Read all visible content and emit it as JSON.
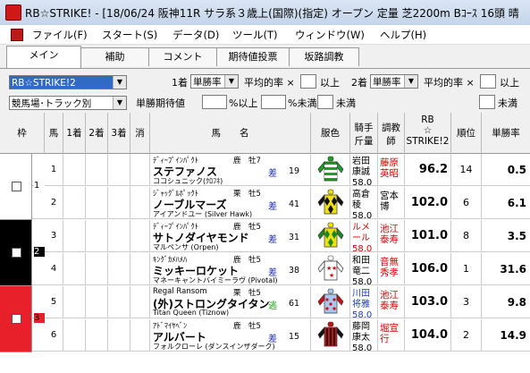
{
  "window": {
    "title": "RB☆STRIKE! - [18/06/24 阪神11R サラ系３歳上(国際)(指定) オープン 定量 芝2200m Bｺｰｽ 16頭 晴"
  },
  "menu": [
    {
      "label": "ファイル(F)"
    },
    {
      "label": "スタート(S)"
    },
    {
      "label": "データ(D)"
    },
    {
      "label": "ツール(T)"
    },
    {
      "label": "ウィンドウ(W)"
    },
    {
      "label": "ヘルプ(H)"
    }
  ],
  "tabs": [
    {
      "label": "メイン"
    },
    {
      "label": "補助"
    },
    {
      "label": "コメント"
    },
    {
      "label": "期待値投票"
    },
    {
      "label": "坂路調教"
    }
  ],
  "filters": {
    "index_select": "RB☆STRIKE!2",
    "course_select": "競馬場･トラック別",
    "bet1_label": "1着",
    "bet1_value": "単勝率",
    "avg1_label": "平均的率 ×",
    "above1": "以上",
    "bet2_label": "2着",
    "bet2_value": "単勝率",
    "avg2_label": "平均的率 ×",
    "above2": "以上",
    "ev_label": "単勝期待値",
    "ev_unit_above": "%以上",
    "ev_unit_below": "%未満",
    "below1": "未満",
    "below2": "未満"
  },
  "columns": {
    "waku": "枠",
    "uma": "馬",
    "c1": "1着",
    "c2": "2着",
    "c3": "3着",
    "kesu": "消",
    "name": "馬　　名",
    "silk": "服色",
    "jockey": "騎手/斤量",
    "trainer": "調教/師",
    "rb": "RB/☆/STRIKE!2",
    "rank": "順位",
    "win": "単勝率"
  },
  "horses": [
    {
      "waku": "1",
      "num": "1",
      "sire": "ﾃﾞｨｰﾌﾟｲﾝﾊﾟｸﾄ",
      "sex_age": "鹿　牡7",
      "name": "ステファノス",
      "dam": "ココシュニック(ｸﾛﾌﾈ)",
      "mark": "差",
      "days": "19",
      "jockey1": "岩田",
      "jockey2": "康誠",
      "weight": "58.0",
      "trainer1": "藤原",
      "trainer2": "英昭",
      "trainer_red": true,
      "rb": "96.2",
      "rank": "14",
      "win": "0.5",
      "silk": {
        "body": "#1ea020",
        "sleeve": "#1ea020",
        "pattern": "hoops-white",
        "cap": "#1ea020"
      }
    },
    {
      "waku": "1",
      "num": "2",
      "sire": "ｼﾞｬｯｸﾞﾙﾎﾟｯｸﾄ",
      "sex_age": "栗　牡5",
      "name": "ノーブルマーズ",
      "dam": "アイアンドユー (Silver Hawk)",
      "mark": "差",
      "days": "41",
      "jockey1": "高倉",
      "jockey2": "稜",
      "weight": "58.0",
      "trainer1": "宮本",
      "trainer2": "博",
      "trainer_red": false,
      "rb": "102.0",
      "rank": "6",
      "win": "6.1",
      "silk": {
        "body": "#f0e010",
        "sleeve": "#111111",
        "pattern": "diamonds-black",
        "cap": "#f0e010"
      }
    },
    {
      "waku": "2",
      "num": "3",
      "sire": "ﾃﾞｨｰﾌﾟｲﾝﾊﾟｸﾄ",
      "sex_age": "鹿　牡5",
      "name": "サトノダイヤモンド",
      "dam": "マルペンサ (Orpen)",
      "mark": "差",
      "days": "31",
      "jockey1": "ルメ",
      "jockey2": "ール",
      "weight": "58.0",
      "jockey_red": true,
      "trainer1": "池江",
      "trainer2": "泰寿",
      "trainer_red": true,
      "rb": "101.0",
      "rank": "8",
      "win": "3.5",
      "silk": {
        "body": "#f0e010",
        "sleeve": "#1a8a20",
        "pattern": "diamonds-green",
        "cap": "#f0e010"
      }
    },
    {
      "waku": "2",
      "num": "4",
      "sire": "ｷﾝｸﾞｶﾒﾊﾒﾊ",
      "sex_age": "鹿　牡5",
      "name": "ミッキーロケット",
      "dam": "マネーキャントバイミーラヴ (Pivotal)",
      "mark": "差",
      "days": "38",
      "jockey1": "和田",
      "jockey2": "竜二",
      "weight": "58.0",
      "trainer1": "音無",
      "trainer2": "秀孝",
      "trainer_red": true,
      "rb": "106.0",
      "rank": "1",
      "win": "31.6",
      "silk": {
        "body": "#ffffff",
        "sleeve": "#ffffff",
        "pattern": "stars-red",
        "cap": "#ffffff"
      }
    },
    {
      "waku": "3",
      "num": "5",
      "sire": "Regal Ransom",
      "sex_age": "栗　牡5",
      "name": "(外)ストロングタイタン",
      "dam": "Titan Queen (Tiznow)",
      "mark": "逃",
      "days": "61",
      "jockey1": "川田",
      "jockey2": "将雅",
      "weight": "58.0",
      "jockey_blue": true,
      "trainer1": "池江",
      "trainer2": "泰寿",
      "trainer_red": true,
      "rb": "103.0",
      "rank": "3",
      "win": "9.8",
      "silk": {
        "body": "#a8c8f0",
        "sleeve": "#d01010",
        "pattern": "dots-red",
        "cap": "#a8c8f0"
      }
    },
    {
      "waku": "3",
      "num": "6",
      "sire": "ｱﾄﾞﾏｲﾔﾍﾞﾝ",
      "sex_age": "鹿　牡5",
      "name": "アルバート",
      "dam": "フォルクローレ (ダンスインザダーク)",
      "mark": "差",
      "days": "15",
      "jockey1": "藤岡",
      "jockey2": "康太",
      "weight": "58.0",
      "trainer1": "堀宣",
      "trainer2": "行",
      "trainer_red": true,
      "rb": "104.0",
      "rank": "2",
      "win": "14.9",
      "silk": {
        "body": "#d01010",
        "sleeve": "#111111",
        "pattern": "stripes-black",
        "cap": "#d01010"
      }
    }
  ],
  "waku_groups": [
    {
      "label": "1",
      "color": "#ffffff",
      "text": "#000000"
    },
    {
      "label": "2",
      "color": "#000000",
      "text": "#ffffff"
    },
    {
      "label": "3",
      "color": "#e8202a",
      "text": "#000000"
    }
  ]
}
